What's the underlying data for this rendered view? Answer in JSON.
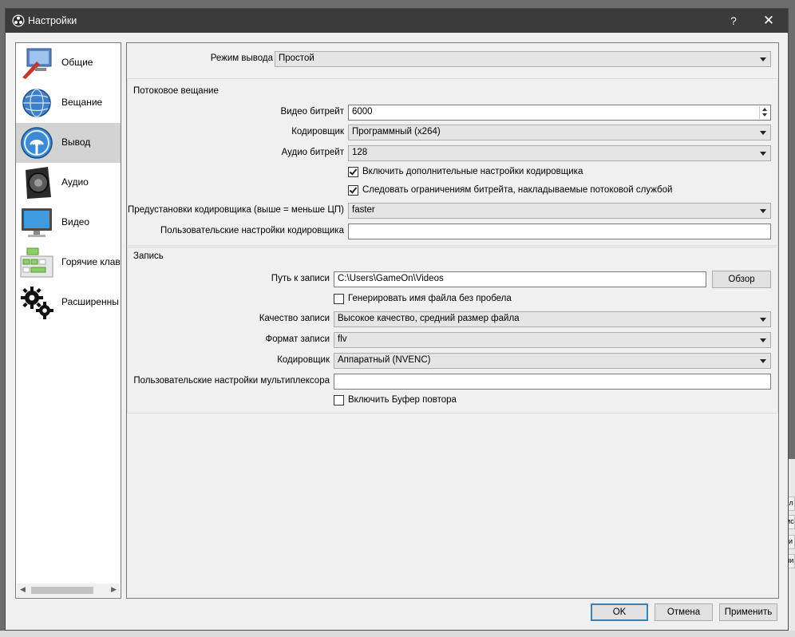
{
  "window": {
    "title": "Настройки",
    "help_label": "?",
    "close_label": "✕"
  },
  "sidebar": {
    "items": [
      {
        "label": "Общие",
        "icon": "general-settings-icon"
      },
      {
        "label": "Вещание",
        "icon": "broadcast-globe-icon"
      },
      {
        "label": "Вывод",
        "icon": "output-antenna-icon",
        "active": true
      },
      {
        "label": "Аудио",
        "icon": "speaker-icon"
      },
      {
        "label": "Видео",
        "icon": "monitor-icon"
      },
      {
        "label": "Горячие клав",
        "icon": "hotkeys-keyboard-icon"
      },
      {
        "label": "Расширенны",
        "icon": "gears-icon"
      }
    ]
  },
  "output": {
    "mode_label": "Режим вывода",
    "mode_value": "Простой",
    "streaming": {
      "title": "Потоковое вещание",
      "video_bitrate_label": "Видео битрейт",
      "video_bitrate_value": "6000",
      "encoder_label": "Кодировщик",
      "encoder_value": "Программный (x264)",
      "audio_bitrate_label": "Аудио битрейт",
      "audio_bitrate_value": "128",
      "advanced_encoder_label": "Включить дополнительные настройки кодировщика",
      "advanced_encoder_checked": true,
      "enforce_limits_label": "Следовать ограничениям битрейта, накладываемые потоковой службой",
      "enforce_limits_checked": true,
      "preset_label": "Предустановки кодировщика (выше = меньше ЦП)",
      "preset_value": "faster",
      "custom_settings_label": "Пользовательские настройки кодировщика",
      "custom_settings_value": ""
    },
    "recording": {
      "title": "Запись",
      "path_label": "Путь к записи",
      "path_value": "C:\\Users\\GameOn\\Videos",
      "browse_label": "Обзор",
      "no_space_label": "Генерировать имя файла без пробела",
      "no_space_checked": false,
      "quality_label": "Качество записи",
      "quality_value": "Высокое качество, средний размер файла",
      "format_label": "Формат записи",
      "format_value": "flv",
      "encoder_label": "Кодировщик",
      "encoder_value": "Аппаратный (NVENC)",
      "muxer_label": "Пользовательские настройки мультиплексора",
      "muxer_value": "",
      "replay_buffer_label": "Включить Буфер повтора",
      "replay_buffer_checked": false
    }
  },
  "footer": {
    "ok_label": "OK",
    "cancel_label": "Отмена",
    "apply_label": "Применить"
  },
  "background": {
    "peek_1": "сл",
    "peek_2": "мс",
    "peek_3": "ки",
    "peek_4": "ли"
  },
  "colors": {
    "titlebar": "#3b3b3b",
    "accent": "#3c7fb1",
    "active_item": "#d3d3d3"
  }
}
